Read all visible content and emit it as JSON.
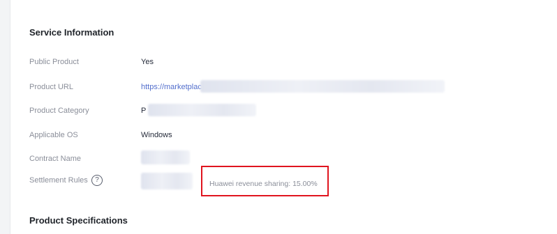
{
  "service_info": {
    "title": "Service Information",
    "rows": {
      "public_product": {
        "label": "Public Product",
        "value": "Yes"
      },
      "product_url": {
        "label": "Product URL",
        "value": "https://marketplac"
      },
      "product_category": {
        "label": "Product Category",
        "value": "P"
      },
      "applicable_os": {
        "label": "Applicable OS",
        "value": "Windows"
      },
      "contract_name": {
        "label": "Contract Name",
        "value": ""
      },
      "settlement_rules": {
        "label": "Settlement Rules",
        "help_icon": "?",
        "revenue_note": "Huawei revenue sharing: 15.00%"
      }
    }
  },
  "product_specs": {
    "title": "Product Specifications"
  },
  "colors": {
    "link": "#526ecc",
    "highlight_border": "#e0141e",
    "label": "#8a8e99"
  }
}
